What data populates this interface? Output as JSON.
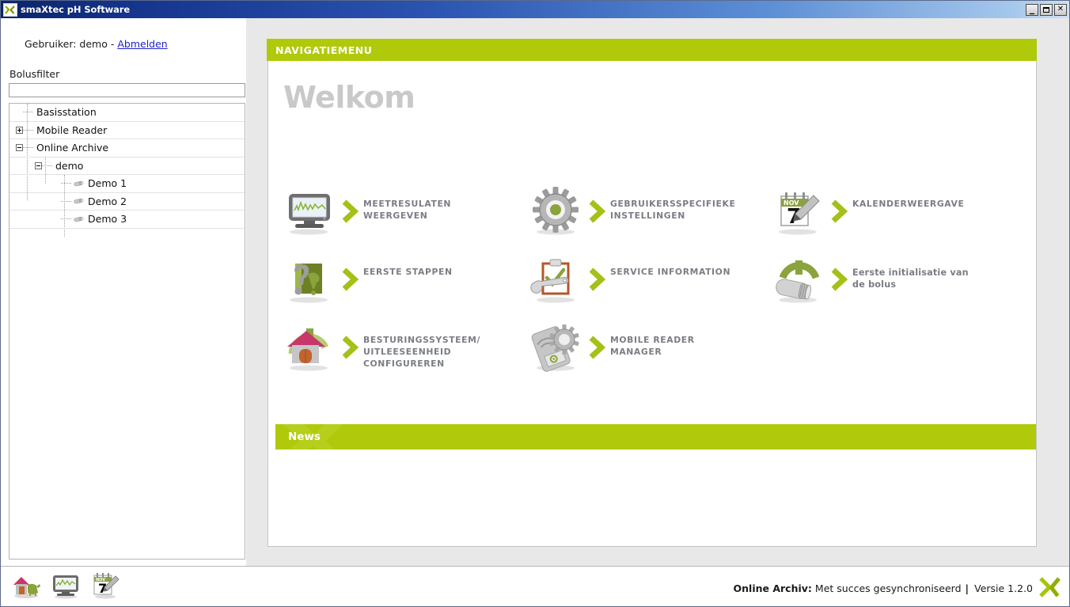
{
  "window": {
    "title": "smaXtec pH Software",
    "icon": "smaxtec-x-logo-icon",
    "minimize_label": "_",
    "maximize_label": "",
    "close_label": "✕"
  },
  "sidebar": {
    "user_prefix": "Gebruiker: demo - ",
    "user_name": "demo",
    "logout_label": "Abmelden",
    "filter_label": "Bolusfilter",
    "filter_value": "",
    "filter_placeholder": "",
    "tree": [
      {
        "label": "Basisstation",
        "depth": 0,
        "twisty": "none",
        "icon": "none"
      },
      {
        "label": "Mobile Reader",
        "depth": 0,
        "twisty": "plus",
        "icon": "none"
      },
      {
        "label": "Online Archive",
        "depth": 0,
        "twisty": "minus",
        "icon": "none"
      },
      {
        "label": "demo",
        "depth": 1,
        "twisty": "minus",
        "icon": "none"
      },
      {
        "label": "Demo 1",
        "depth": 2,
        "twisty": "none",
        "icon": "bolus-icon"
      },
      {
        "label": "Demo 2",
        "depth": 2,
        "twisty": "none",
        "icon": "bolus-icon"
      },
      {
        "label": "Demo 3",
        "depth": 2,
        "twisty": "none",
        "icon": "bolus-icon"
      }
    ]
  },
  "main": {
    "nav_header": "NAVIGATIEMENU",
    "welcome": "Welkom",
    "news_title": "News",
    "tiles": [
      {
        "label": "MEETRESULATEN\nWEERGEVEN",
        "icon": "monitor-chart-icon",
        "style": "upper"
      },
      {
        "label": "GEBRUIKERSSPECIFIEKE\nINSTELLINGEN",
        "icon": "gear-settings-icon",
        "style": "upper"
      },
      {
        "label": "KALENDERWEERGAVE",
        "icon": "calendar-pen-icon",
        "style": "upper"
      },
      {
        "label": "EERSTE STAPPEN",
        "icon": "question-cow-icon",
        "style": "upper"
      },
      {
        "label": "SERVICE INFORMATION",
        "icon": "clipboard-wrench-icon",
        "style": "upper"
      },
      {
        "label": "Eerste initialisatie van\nde bolus",
        "icon": "bolus-arc-icon",
        "style": "mixed"
      },
      {
        "label": "BESTURINGSSYSTEEM/\nUITLEESEENHEID\nCONFIGUREREN",
        "icon": "house-arc-icon",
        "style": "upper"
      },
      {
        "label": "MOBILE READER\nMANAGER",
        "icon": "reader-gear-icon",
        "style": "upper"
      }
    ]
  },
  "statusbar": {
    "taskbar_icons": [
      "house-cow-icon",
      "monitor-chart-icon",
      "calendar-pen-icon"
    ],
    "sync_label": "Online Archiv:",
    "sync_text": "Met succes gesynchroniseerd",
    "separator": "|",
    "version": "Versie 1.2.0",
    "logo": "smaxtec-x-logo-icon"
  },
  "colors": {
    "brand_green": "#b0c90a",
    "title_blue": "#0a246a",
    "label_gray": "#7b7d85",
    "welcome_gray": "#c9c9c9"
  }
}
